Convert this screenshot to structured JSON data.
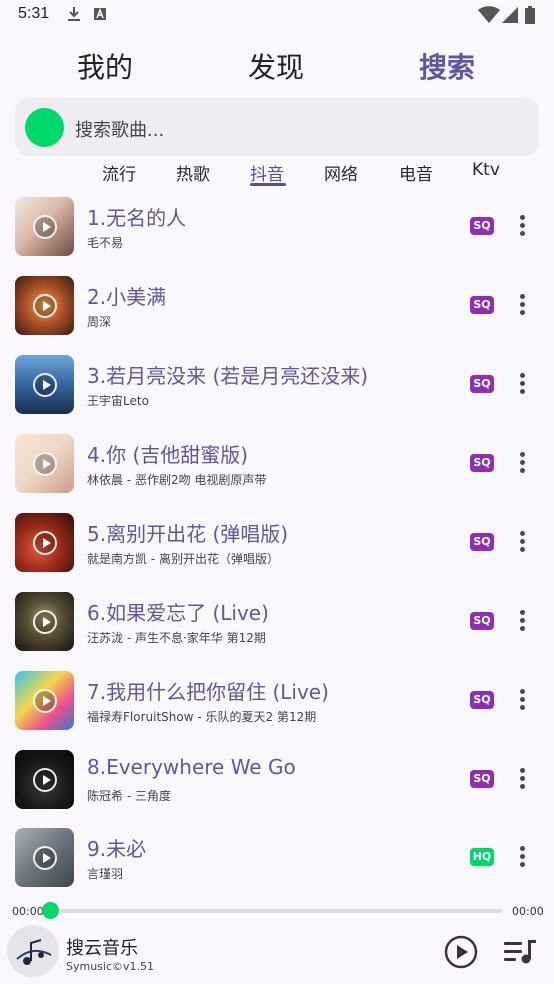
{
  "status": {
    "time": "5:31"
  },
  "top_tabs": [
    {
      "label": "我的"
    },
    {
      "label": "发现"
    },
    {
      "label": "搜索"
    }
  ],
  "search": {
    "placeholder": "搜索歌曲..."
  },
  "categories": [
    {
      "label": "流行"
    },
    {
      "label": "热歌"
    },
    {
      "label": "抖音"
    },
    {
      "label": "网络"
    },
    {
      "label": "电音"
    },
    {
      "label": "Ktv"
    }
  ],
  "songs": [
    {
      "title": "1.无名的人",
      "artist": "毛不易",
      "quality": "SQ"
    },
    {
      "title": "2.小美满",
      "artist": "周深",
      "quality": "SQ"
    },
    {
      "title": "3.若月亮没来 (若是月亮还没来)",
      "artist": "王宇宙Leto",
      "quality": "SQ"
    },
    {
      "title": "4.你 (吉他甜蜜版)",
      "artist": "林依晨 - 恶作剧2吻 电视剧原声带",
      "quality": "SQ"
    },
    {
      "title": "5.离别开出花 (弹唱版)",
      "artist": "就是南方凯 - 离别开出花（弹唱版）",
      "quality": "SQ"
    },
    {
      "title": "6.如果爱忘了 (Live)",
      "artist": "汪苏泷 - 声生不息·家年华 第12期",
      "quality": "SQ"
    },
    {
      "title": "7.我用什么把你留住 (Live)",
      "artist": "福禄寿FloruitShow - 乐队的夏天2 第12期",
      "quality": "SQ"
    },
    {
      "title": "8.Everywhere We Go",
      "artist": "陈冠希 - 三角度",
      "quality": "SQ"
    },
    {
      "title": "9.未必",
      "artist": "言瑾羽",
      "quality": "HQ"
    }
  ],
  "player": {
    "current_time": "00:00",
    "total_time": "00:00",
    "progress": 0,
    "title": "搜云音乐",
    "version": "Symusic©v1.51"
  },
  "colors": {
    "accent": "#63559b",
    "green": "#00d86c",
    "sq_badge": "#8d2fb0",
    "hq_badge": "#00d86c"
  }
}
